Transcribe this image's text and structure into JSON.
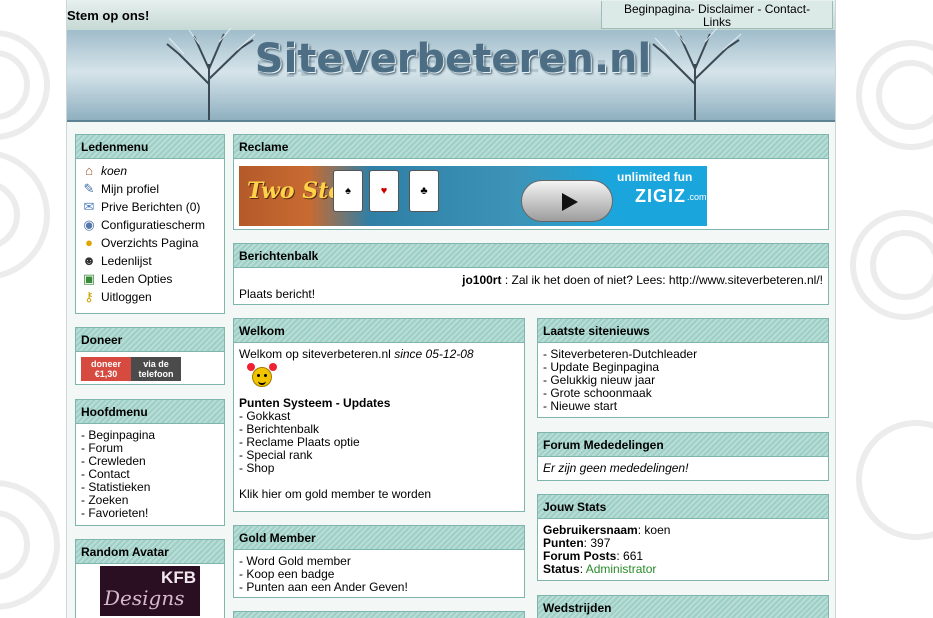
{
  "header": {
    "vote_label": "Stem op ons!",
    "site_title": "Siteverbeteren.nl",
    "nav": {
      "home": "Beginpagina",
      "disclaimer": "Disclaimer",
      "contact": "Contact",
      "links": "Links"
    }
  },
  "ledenmenu": {
    "title": "Ledenmenu",
    "items": [
      {
        "label": "koen",
        "icon": "home-icon"
      },
      {
        "label": "Mijn profiel",
        "icon": "profile-edit-icon"
      },
      {
        "label": "Prive Berichten (0)",
        "icon": "mail-icon"
      },
      {
        "label": "Configuratiescherm",
        "icon": "eye-icon"
      },
      {
        "label": "Overzichts Pagina",
        "icon": "overview-icon"
      },
      {
        "label": "Ledenlijst",
        "icon": "user-icon"
      },
      {
        "label": "Leden Opties",
        "icon": "options-icon"
      },
      {
        "label": "Uitloggen",
        "icon": "key-icon"
      }
    ]
  },
  "doneer": {
    "title": "Doneer",
    "button_left": "doneer €1,30",
    "button_right": "via de telefoon"
  },
  "hoofdmenu": {
    "title": "Hoofdmenu",
    "items": [
      "Beginpagina",
      "Forum",
      "Crewleden",
      "Contact",
      "Statistieken",
      "Zoeken",
      "Favorieten!"
    ]
  },
  "random_avatar": {
    "title": "Random Avatar",
    "text_top": "KFB",
    "text_bottom": "Designs"
  },
  "reclame": {
    "title": "Reclame",
    "ad_logo": "Two Step",
    "ad_slogan": "unlimited fun",
    "ad_brand": "ZIGIZ",
    "ad_domain": ".com"
  },
  "berichtenbalk": {
    "title": "Berichtenbalk",
    "ticker_user": "jo100rt",
    "ticker_text": " : Zal ik het doen of niet? Lees: http://www.siteverbeteren.nl/!",
    "post_link": "Plaats bericht!"
  },
  "welkom": {
    "title": "Welkom",
    "intro_prefix": "Welkom op siteverbeteren.nl",
    "intro_since": "since 05-12-08",
    "updates_heading": "Punten Systeem - Updates",
    "updates": [
      "Gokkast",
      "Berichtenbalk",
      "Reclame Plaats optie",
      "Special rank",
      "Shop"
    ],
    "gold_cta": "Klik hier om gold member te worden"
  },
  "gold_member": {
    "title": "Gold Member",
    "items": [
      "Word Gold member",
      "Koop een badge",
      "Punten aan een Ander Geven!"
    ]
  },
  "laatste_nieuws": {
    "title": "Laatste sitenieuws",
    "items": [
      "Siteverbeteren-Dutchleader",
      "Update Beginpagina",
      "Gelukkig nieuw jaar",
      "Grote schoonmaak",
      "Nieuwe start"
    ]
  },
  "forum_mededelingen": {
    "title": "Forum Mededelingen",
    "text": "Er zijn geen mededelingen!"
  },
  "jouw_stats": {
    "title": "Jouw Stats",
    "rows": [
      {
        "label": "Gebruikersnaam",
        "value": "koen"
      },
      {
        "label": "Punten",
        "value": "397"
      },
      {
        "label": "Forum Posts",
        "value": "661"
      },
      {
        "label": "Status",
        "value": "Administrator"
      }
    ]
  },
  "wedstrijden": {
    "title": "Wedstrijden"
  },
  "colors": {
    "box_border": "#7fb5ad",
    "box_header": "#9ccfc6",
    "status_green": "#2a8a2a"
  }
}
